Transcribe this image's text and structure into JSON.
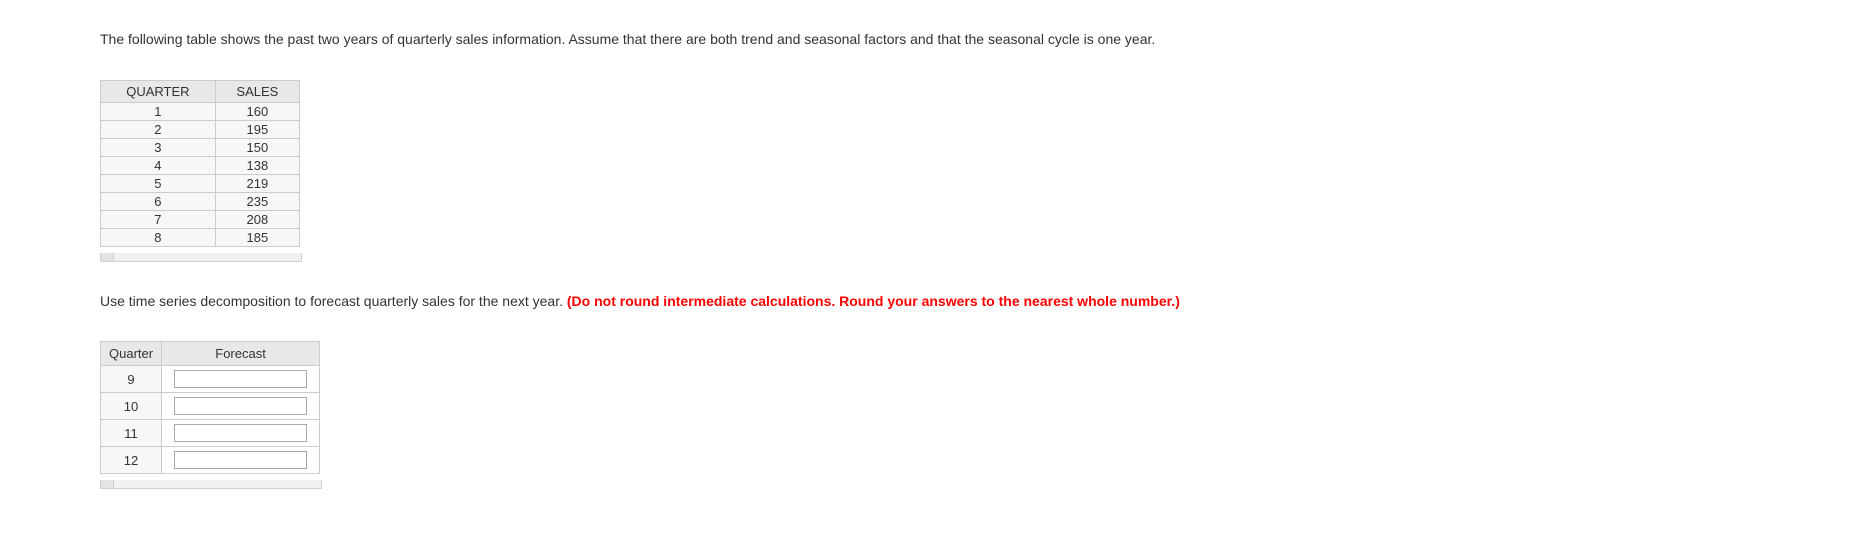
{
  "intro": "The following table shows the past two years of quarterly sales information. Assume that there are both trend and seasonal factors and that the seasonal cycle is one year.",
  "sales_table": {
    "headers": [
      "QUARTER",
      "SALES"
    ],
    "rows": [
      {
        "quarter": "1",
        "sales": "160"
      },
      {
        "quarter": "2",
        "sales": "195"
      },
      {
        "quarter": "3",
        "sales": "150"
      },
      {
        "quarter": "4",
        "sales": "138"
      },
      {
        "quarter": "5",
        "sales": "219"
      },
      {
        "quarter": "6",
        "sales": "235"
      },
      {
        "quarter": "7",
        "sales": "208"
      },
      {
        "quarter": "8",
        "sales": "185"
      }
    ]
  },
  "instruction_plain": "Use time series decomposition to forecast quarterly sales for the next year. ",
  "instruction_red": "(Do not round intermediate calculations. Round your answers to the nearest whole number.)",
  "forecast_table": {
    "headers": [
      "Quarter",
      "Forecast"
    ],
    "rows": [
      {
        "quarter": "9",
        "forecast": ""
      },
      {
        "quarter": "10",
        "forecast": ""
      },
      {
        "quarter": "11",
        "forecast": ""
      },
      {
        "quarter": "12",
        "forecast": ""
      }
    ]
  }
}
